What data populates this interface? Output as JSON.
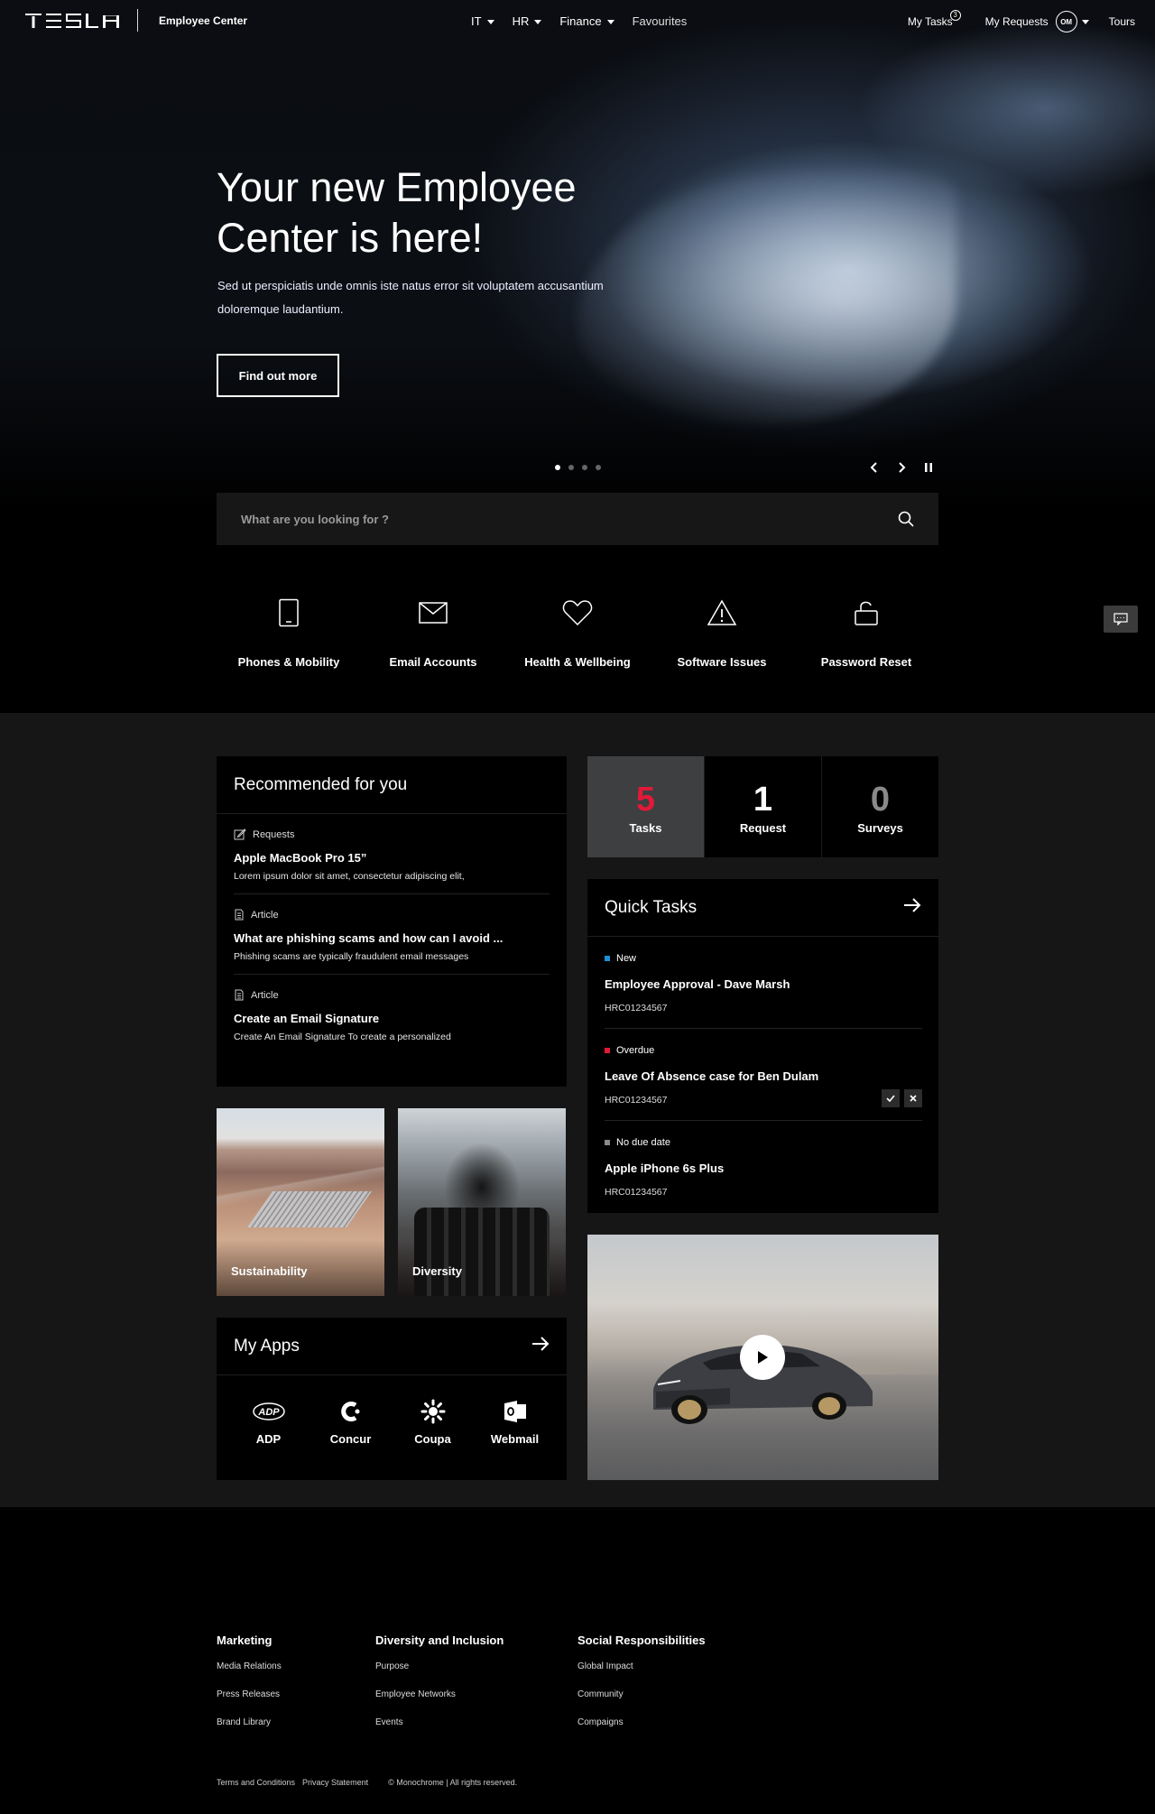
{
  "header": {
    "brand": "TESLA",
    "title": "Employee Center",
    "nav": [
      "IT",
      "HR",
      "Finance"
    ],
    "favourites": "Favourites",
    "my_tasks": "My Tasks",
    "tasks_badge": "3",
    "my_requests": "My Requests",
    "avatar": "OM",
    "tours": "Tours"
  },
  "hero": {
    "title": "Your new Employee Center is here!",
    "subtitle": "Sed ut perspiciatis unde omnis iste natus error sit voluptatem accusantium doloremque laudantium.",
    "cta": "Find out more",
    "slides": 4,
    "active_slide": 1
  },
  "search": {
    "placeholder": "What are you looking for ?"
  },
  "quick_links": [
    {
      "icon": "phone-icon",
      "label": "Phones & Mobility"
    },
    {
      "icon": "mail-icon",
      "label": "Email Accounts"
    },
    {
      "icon": "heart-icon",
      "label": "Health & Wellbeing"
    },
    {
      "icon": "warning-icon",
      "label": "Software Issues"
    },
    {
      "icon": "unlock-icon",
      "label": "Password Reset"
    }
  ],
  "recommended": {
    "title": "Recommended for you",
    "items": [
      {
        "type": "Requests",
        "title": "Apple MacBook Pro 15”",
        "desc": "Lorem ipsum dolor sit amet, consectetur adipiscing elit,"
      },
      {
        "type": "Article",
        "title": "What are phishing scams and how can I avoid ...",
        "desc": "Phishing scams are typically fraudulent email messages"
      },
      {
        "type": "Article",
        "title": "Create an Email Signature",
        "desc": "Create An Email Signature To create a personalized"
      }
    ]
  },
  "stats": [
    {
      "value": "5",
      "label": "Tasks",
      "color": "#e31937"
    },
    {
      "value": "1",
      "label": "Request",
      "color": "#ffffff"
    },
    {
      "value": "0",
      "label": "Surveys",
      "color": "#8a8a8a"
    }
  ],
  "quick_tasks": {
    "title": "Quick Tasks",
    "items": [
      {
        "status": "New",
        "status_color": "#1d8fd6",
        "title": "Employee Approval - Dave Marsh",
        "id": "HRC01234567"
      },
      {
        "status": "Overdue",
        "status_color": "#e31937",
        "title": "Leave Of Absence case for Ben Dulam",
        "id": "HRC01234567"
      },
      {
        "status": "No due date",
        "status_color": "#8a8a8a",
        "title": "Apple iPhone 6s Plus",
        "id": "HRC01234567"
      }
    ]
  },
  "tiles": [
    "Sustainability",
    "Diversity"
  ],
  "apps": {
    "title": "My Apps",
    "items": [
      "ADP",
      "Concur",
      "Coupa",
      "Webmail"
    ]
  },
  "footer": {
    "columns": [
      {
        "title": "Marketing",
        "links": [
          "Media Relations",
          "Press Releases",
          "Brand Library"
        ]
      },
      {
        "title": "Diversity and Inclusion",
        "links": [
          "Purpose",
          "Employee Networks",
          "Events"
        ]
      },
      {
        "title": "Social Responsibilities",
        "links": [
          "Global Impact",
          "Community",
          "Compaigns"
        ]
      }
    ],
    "terms": "Terms and Conditions",
    "privacy": "Privacy Statement",
    "copyright": "© Monochrome |  All rights reserved."
  }
}
